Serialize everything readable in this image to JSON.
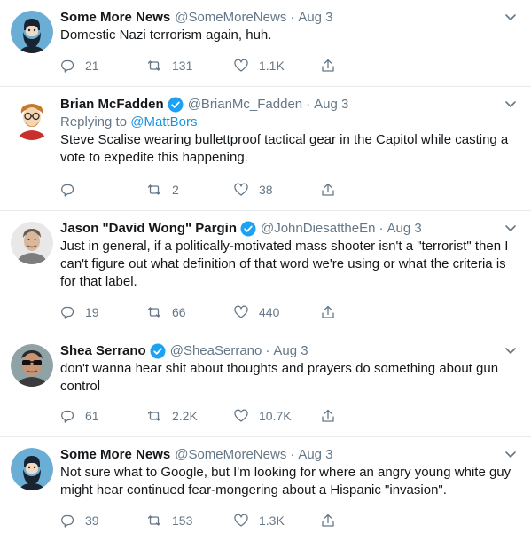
{
  "colors": {
    "name": "#14171a",
    "secondary": "#657786",
    "link": "#1b95e0",
    "verified": "#1da1f2",
    "divider": "#e6ecf0"
  },
  "tweets": [
    {
      "name": "Some More News",
      "verified": false,
      "handle": "@SomeMoreNews",
      "time": "Aug 3",
      "reply_prefix": "",
      "reply_mention": "",
      "text": "Domestic Nazi terrorism again, huh.",
      "replies": "21",
      "retweets": "131",
      "likes": "1.1K",
      "avatar": "bearded-man-illustration"
    },
    {
      "name": "Brian McFadden",
      "verified": true,
      "handle": "@BrianMc_Fadden",
      "time": "Aug 3",
      "reply_prefix": "Replying to ",
      "reply_mention": "@MattBors",
      "text": "Steve Scalise wearing bullettproof tactical gear in the Capitol while casting a vote to expedite this happening.",
      "replies": "",
      "retweets": "2",
      "likes": "38",
      "avatar": "cartoon-man-illustration"
    },
    {
      "name": "Jason \"David Wong\" Pargin",
      "verified": true,
      "handle": "@JohnDiesattheEn",
      "time": "Aug 3",
      "reply_prefix": "",
      "reply_mention": "",
      "text": "Just in general, if a politically-motivated mass shooter isn't a \"terrorist\" then I can't figure out what definition of that word we're using or what the criteria is for that label.",
      "replies": "19",
      "retweets": "66",
      "likes": "440",
      "avatar": "man-portrait"
    },
    {
      "name": "Shea Serrano",
      "verified": true,
      "handle": "@SheaSerrano",
      "time": "Aug 3",
      "reply_prefix": "",
      "reply_mention": "",
      "text": "don't wanna hear shit about thoughts and prayers do something about gun control",
      "replies": "61",
      "retweets": "2.2K",
      "likes": "10.7K",
      "avatar": "man-with-sunglasses"
    },
    {
      "name": "Some More News",
      "verified": false,
      "handle": "@SomeMoreNews",
      "time": "Aug 3",
      "reply_prefix": "",
      "reply_mention": "",
      "text": "Not sure what to Google, but I'm looking for where an angry young white guy might hear continued fear-mongering about a Hispanic \"invasion\".",
      "replies": "39",
      "retweets": "153",
      "likes": "1.3K",
      "avatar": "bearded-man-illustration"
    }
  ],
  "icons": {
    "reply": "reply-icon",
    "retweet": "retweet-icon",
    "like": "heart-icon",
    "share": "share-icon",
    "more": "chevron-down-icon",
    "verified": "verified-badge-icon"
  }
}
